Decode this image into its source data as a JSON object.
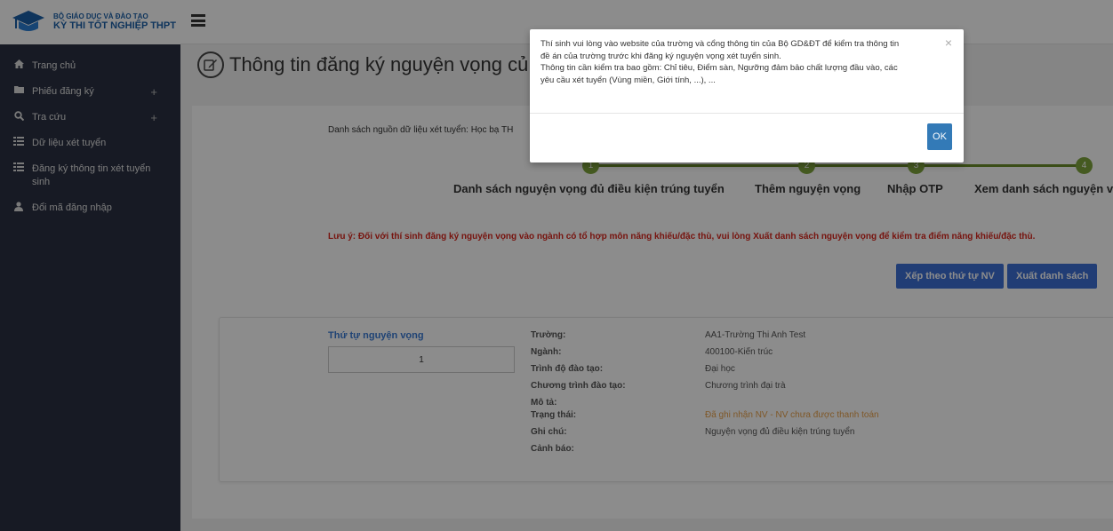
{
  "logo": {
    "line1": "BỘ GIÁO DỤC VÀ ĐÀO TẠO",
    "line2": "KỲ THI TỐT NGHIỆP THPT"
  },
  "sidebar": {
    "items": [
      {
        "label": "Trang chủ",
        "icon": "home-icon",
        "has_plus": false
      },
      {
        "label": "Phiếu đăng ký",
        "icon": "folder-icon",
        "has_plus": true
      },
      {
        "label": "Tra cứu",
        "icon": "search-icon",
        "has_plus": true
      },
      {
        "label": "Dữ liệu xét tuyển",
        "icon": "list-icon",
        "has_plus": false
      },
      {
        "label": "Đăng ký thông tin xét tuyển sinh",
        "icon": "list-icon",
        "has_plus": false
      },
      {
        "label": "Đổi mã đăng nhập",
        "icon": "user-icon",
        "has_plus": false
      }
    ],
    "plus": "+"
  },
  "page": {
    "title": "Thông tin đăng ký nguyện vọng củ"
  },
  "panel": {
    "datasource": "Danh sách nguồn dữ liệu xét tuyển: Học bạ TH",
    "steps": [
      {
        "number": "1",
        "label": "Danh sách nguyện vọng đủ điều kiện trúng tuyển"
      },
      {
        "number": "2",
        "label": "Thêm nguyện vọng"
      },
      {
        "number": "3",
        "label": "Nhập OTP"
      },
      {
        "number": "4",
        "label": "Xem danh sách nguyện v"
      }
    ],
    "note": "Lưu ý: Đối với thí sinh đăng ký nguyện vọng vào ngành có tổ hợp môn năng khiếu/đặc thù, vui lòng Xuất danh sách nguyện vọng để kiểm tra điểm năng khiếu/đặc thù.",
    "sort_button": "Xếp theo thứ tự NV",
    "export_button": "Xuất danh sách"
  },
  "card": {
    "order_label": "Thứ tự nguyện vọng",
    "order_value": "1",
    "rows": [
      {
        "label": "Trường:",
        "value": "AA1-Trường Thi Anh Test"
      },
      {
        "label": "Ngành:",
        "value": "400100-Kiến trúc"
      },
      {
        "label": "Trình độ đào tạo:",
        "value": "Đại học"
      },
      {
        "label": "Chương trình đào tạo:",
        "value": "Chương trình đại trà"
      },
      {
        "label": "Mô tả:",
        "value": ""
      },
      {
        "label": "Trạng thái:",
        "value": "Đã ghi nhận NV - NV chưa được thanh toán"
      },
      {
        "label": "Ghi chú:",
        "value": "Nguyện vọng đủ điều kiện trúng tuyển"
      },
      {
        "label": "Cảnh báo:",
        "value": ""
      }
    ]
  },
  "modal": {
    "line1": "Thí sinh vui lòng vào website của trường và cổng thông tin của Bộ GD&ĐT để kiểm tra thông tin",
    "line2": "đề án của trường trước khi đăng ký nguyện vọng xét tuyển sinh.",
    "line3": "Thông tin cần kiểm tra bao gồm: Chỉ tiêu, Điểm sàn, Ngưỡng đảm bảo chất lượng đầu vào, các",
    "line4": "yêu cầu xét tuyển (Vùng miền, Giới tính, ...), ...",
    "close": "×",
    "ok_button": "OK"
  },
  "colors": {
    "sidebar_bg": "#2a3042",
    "accent_blue": "#3d6fd6",
    "step_green": "#7ea53c",
    "warning_red": "#d9261c",
    "status_orange": "#e8a04a",
    "order_blue": "#3a7bd5"
  }
}
